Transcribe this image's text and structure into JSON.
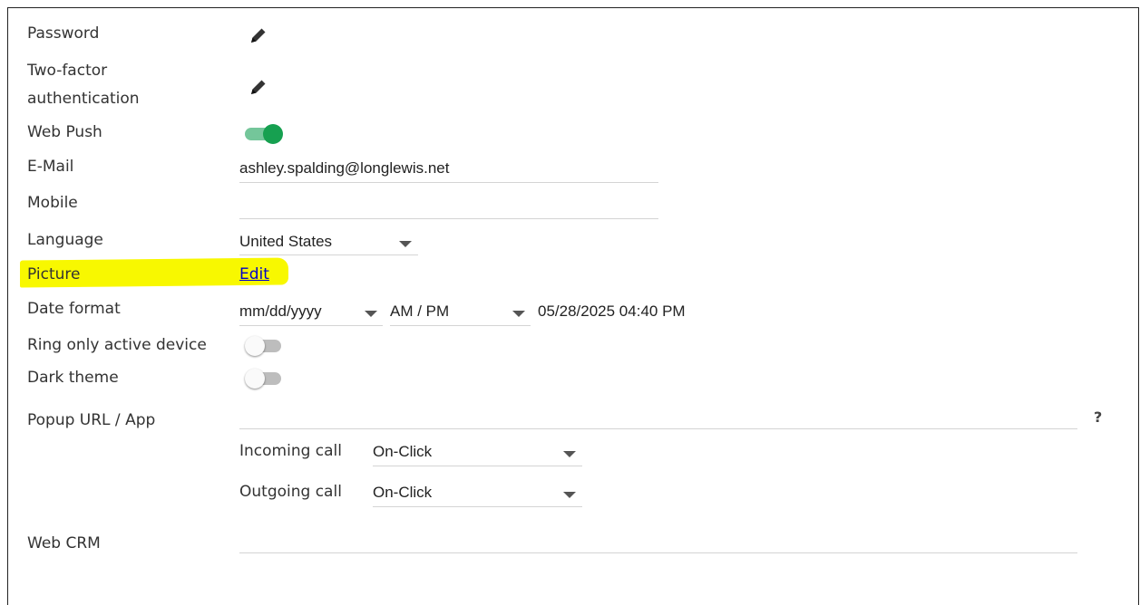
{
  "labels": {
    "password": "Password",
    "two_factor_line1": "Two-factor",
    "two_factor_line2": "authentication",
    "web_push": "Web Push",
    "email": "E-Mail",
    "mobile": "Mobile",
    "language": "Language",
    "picture": "Picture",
    "date_format": "Date format",
    "ring_only": "Ring only active device",
    "dark_theme": "Dark theme",
    "popup_url": "Popup URL / App",
    "incoming_call": "Incoming call",
    "outgoing_call": "Outgoing call",
    "web_crm": "Web CRM"
  },
  "values": {
    "email": "ashley.spalding@longlewis.net",
    "mobile": "",
    "language": "United States",
    "picture_link": "Edit",
    "date_format": "mm/dd/yyyy",
    "time_format": "AM / PM",
    "date_preview": "05/28/2025 04:40 PM",
    "popup_url": "",
    "incoming_call": "On-Click",
    "outgoing_call": "On-Click",
    "web_crm": "",
    "help_mark": "?"
  },
  "toggles": {
    "web_push": true,
    "ring_only": false,
    "dark_theme": false
  },
  "colors": {
    "highlight": "#f8f800",
    "toggle_on_knob": "#16a050",
    "toggle_on_track": "#74c69a",
    "link": "#0000cc"
  },
  "icons": {
    "password_edit": "pencil-icon",
    "two_factor_edit": "pencil-icon"
  }
}
